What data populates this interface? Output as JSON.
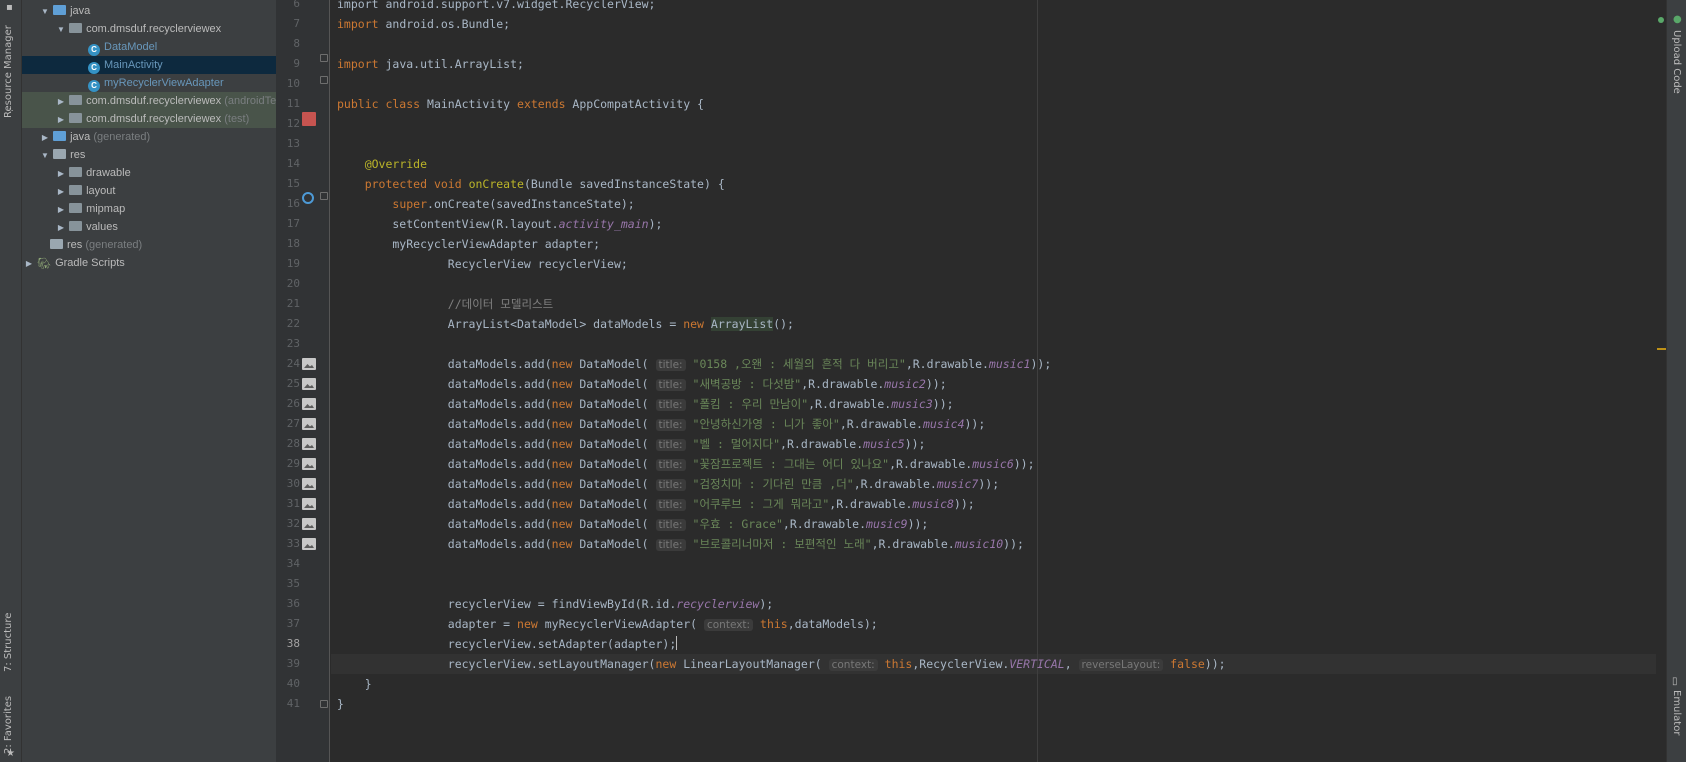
{
  "left_strip": {
    "tabs": [
      {
        "label": "Resource Manager"
      },
      {
        "label": "7: Structure"
      },
      {
        "label": "2: Favorites"
      }
    ]
  },
  "project_tree": {
    "rows": [
      {
        "text": "java",
        "suffix": ""
      },
      {
        "text": "com.dmsduf.recyclerviewex",
        "suffix": ""
      },
      {
        "text": "DataModel",
        "suffix": ""
      },
      {
        "text": "MainActivity",
        "suffix": ""
      },
      {
        "text": "myRecyclerViewAdapter",
        "suffix": ""
      },
      {
        "text": "com.dmsduf.recyclerviewex",
        "suffix": "(androidTes"
      },
      {
        "text": "com.dmsduf.recyclerviewex",
        "suffix": "(test)"
      },
      {
        "text": "java",
        "suffix": "(generated)"
      },
      {
        "text": "res",
        "suffix": ""
      },
      {
        "text": "drawable",
        "suffix": ""
      },
      {
        "text": "layout",
        "suffix": ""
      },
      {
        "text": "mipmap",
        "suffix": ""
      },
      {
        "text": "values",
        "suffix": ""
      },
      {
        "text": "res",
        "suffix": "(generated)"
      },
      {
        "text": "Gradle Scripts",
        "suffix": ""
      }
    ]
  },
  "gutter": {
    "line_numbers": [
      "6",
      "7",
      "8",
      "9",
      "10",
      "11",
      "12",
      "13",
      "14",
      "15",
      "16",
      "17",
      "18",
      "19",
      "20",
      "21",
      "22",
      "23",
      "24",
      "25",
      "26",
      "27",
      "28",
      "29",
      "30",
      "31",
      "32",
      "33",
      "34",
      "35",
      "36",
      "37",
      "38",
      "39",
      "40",
      "41"
    ]
  },
  "code": {
    "lines": [
      [
        {
          "t": "plain",
          "v": "import android.support.v7.widget.RecyclerView;"
        }
      ],
      [
        {
          "t": "kw",
          "v": "import "
        },
        {
          "t": "plain",
          "v": "android.os.Bundle;"
        }
      ],
      [],
      [
        {
          "t": "kw",
          "v": "import "
        },
        {
          "t": "plain",
          "v": "java.util.ArrayList;"
        }
      ],
      [],
      [
        {
          "t": "kw",
          "v": "public class "
        },
        {
          "t": "plain",
          "v": "MainActivity "
        },
        {
          "t": "kw",
          "v": "extends "
        },
        {
          "t": "plain",
          "v": "AppCompatActivity {"
        }
      ],
      [],
      [],
      [
        {
          "t": "plain",
          "v": "    "
        },
        {
          "t": "ann",
          "v": "@Override"
        }
      ],
      [
        {
          "t": "plain",
          "v": "    "
        },
        {
          "t": "kw",
          "v": "protected void "
        },
        {
          "t": "ann",
          "v": "onCreate"
        },
        {
          "t": "plain",
          "v": "(Bundle savedInstanceState) {"
        }
      ],
      [
        {
          "t": "plain",
          "v": "        "
        },
        {
          "t": "kw",
          "v": "super"
        },
        {
          "t": "plain",
          "v": ".onCreate(savedInstanceState);"
        }
      ],
      [
        {
          "t": "plain",
          "v": "        setContentView(R.layout."
        },
        {
          "t": "italic",
          "v": "activity_main"
        },
        {
          "t": "plain",
          "v": ");"
        }
      ],
      [
        {
          "t": "plain",
          "v": "        myRecyclerViewAdapter adapter;"
        }
      ],
      [
        {
          "t": "plain",
          "v": "                RecyclerView recyclerView;"
        }
      ],
      [],
      [
        {
          "t": "plain",
          "v": "                "
        },
        {
          "t": "com",
          "v": "//데이터 모델리스트"
        }
      ],
      [
        {
          "t": "plain",
          "v": "                ArrayList<DataModel> dataModels = "
        },
        {
          "t": "kw",
          "v": "new "
        },
        {
          "t": "hl",
          "v": "ArrayList"
        },
        {
          "t": "plain",
          "v": "();"
        }
      ],
      [],
      [
        {
          "t": "plain",
          "v": "                dataModels.add("
        },
        {
          "t": "kw",
          "v": "new "
        },
        {
          "t": "plain",
          "v": "DataModel( "
        },
        {
          "t": "hint",
          "v": "title:"
        },
        {
          "t": "str",
          "v": " \"0158 ,오왠 : 세월의 흔적 다 버리고\""
        },
        {
          "t": "plain",
          "v": ",R.drawable."
        },
        {
          "t": "italic",
          "v": "music1"
        },
        {
          "t": "plain",
          "v": "));"
        }
      ],
      [
        {
          "t": "plain",
          "v": "                dataModels.add("
        },
        {
          "t": "kw",
          "v": "new "
        },
        {
          "t": "plain",
          "v": "DataModel( "
        },
        {
          "t": "hint",
          "v": "title:"
        },
        {
          "t": "str",
          "v": " \"새벽공방 : 다섯밤\""
        },
        {
          "t": "plain",
          "v": ",R.drawable."
        },
        {
          "t": "italic",
          "v": "music2"
        },
        {
          "t": "plain",
          "v": "));"
        }
      ],
      [
        {
          "t": "plain",
          "v": "                dataModels.add("
        },
        {
          "t": "kw",
          "v": "new "
        },
        {
          "t": "plain",
          "v": "DataModel( "
        },
        {
          "t": "hint",
          "v": "title:"
        },
        {
          "t": "str",
          "v": " \"폴킴 : 우리 만남이\""
        },
        {
          "t": "plain",
          "v": ",R.drawable."
        },
        {
          "t": "italic",
          "v": "music3"
        },
        {
          "t": "plain",
          "v": "));"
        }
      ],
      [
        {
          "t": "plain",
          "v": "                dataModels.add("
        },
        {
          "t": "kw",
          "v": "new "
        },
        {
          "t": "plain",
          "v": "DataModel( "
        },
        {
          "t": "hint",
          "v": "title:"
        },
        {
          "t": "str",
          "v": " \"안녕하신가영 : 니가 좋아\""
        },
        {
          "t": "plain",
          "v": ",R.drawable."
        },
        {
          "t": "italic",
          "v": "music4"
        },
        {
          "t": "plain",
          "v": "));"
        }
      ],
      [
        {
          "t": "plain",
          "v": "                dataModels.add("
        },
        {
          "t": "kw",
          "v": "new "
        },
        {
          "t": "plain",
          "v": "DataModel( "
        },
        {
          "t": "hint",
          "v": "title:"
        },
        {
          "t": "str",
          "v": " \"벨 : 멀어지다\""
        },
        {
          "t": "plain",
          "v": ",R.drawable."
        },
        {
          "t": "italic",
          "v": "music5"
        },
        {
          "t": "plain",
          "v": "));"
        }
      ],
      [
        {
          "t": "plain",
          "v": "                dataModels.add("
        },
        {
          "t": "kw",
          "v": "new "
        },
        {
          "t": "plain",
          "v": "DataModel( "
        },
        {
          "t": "hint",
          "v": "title:"
        },
        {
          "t": "str",
          "v": " \"꽃잠프로젝트 : 그대는 어디 있나요\""
        },
        {
          "t": "plain",
          "v": ",R.drawable."
        },
        {
          "t": "italic",
          "v": "music6"
        },
        {
          "t": "plain",
          "v": "));"
        }
      ],
      [
        {
          "t": "plain",
          "v": "                dataModels.add("
        },
        {
          "t": "kw",
          "v": "new "
        },
        {
          "t": "plain",
          "v": "DataModel( "
        },
        {
          "t": "hint",
          "v": "title:"
        },
        {
          "t": "str",
          "v": " \"검정치마 : 기다린 만큼 ,더\""
        },
        {
          "t": "plain",
          "v": ",R.drawable."
        },
        {
          "t": "italic",
          "v": "music7"
        },
        {
          "t": "plain",
          "v": "));"
        }
      ],
      [
        {
          "t": "plain",
          "v": "                dataModels.add("
        },
        {
          "t": "kw",
          "v": "new "
        },
        {
          "t": "plain",
          "v": "DataModel( "
        },
        {
          "t": "hint",
          "v": "title:"
        },
        {
          "t": "str",
          "v": " \"어쿠루브 : 그게 뭐라고\""
        },
        {
          "t": "plain",
          "v": ",R.drawable."
        },
        {
          "t": "italic",
          "v": "music8"
        },
        {
          "t": "plain",
          "v": "));"
        }
      ],
      [
        {
          "t": "plain",
          "v": "                dataModels.add("
        },
        {
          "t": "kw",
          "v": "new "
        },
        {
          "t": "plain",
          "v": "DataModel( "
        },
        {
          "t": "hint",
          "v": "title:"
        },
        {
          "t": "str",
          "v": " \"우효 : Grace\""
        },
        {
          "t": "plain",
          "v": ",R.drawable."
        },
        {
          "t": "italic",
          "v": "music9"
        },
        {
          "t": "plain",
          "v": "));"
        }
      ],
      [
        {
          "t": "plain",
          "v": "                dataModels.add("
        },
        {
          "t": "kw",
          "v": "new "
        },
        {
          "t": "plain",
          "v": "DataModel( "
        },
        {
          "t": "hint",
          "v": "title:"
        },
        {
          "t": "str",
          "v": " \"브로콜리너마저 : 보편적인 노래\""
        },
        {
          "t": "plain",
          "v": ",R.drawable."
        },
        {
          "t": "italic",
          "v": "music10"
        },
        {
          "t": "plain",
          "v": "));"
        }
      ],
      [],
      [],
      [
        {
          "t": "plain",
          "v": "                recyclerView = findViewById(R.id."
        },
        {
          "t": "italic",
          "v": "recyclerview"
        },
        {
          "t": "plain",
          "v": ");"
        }
      ],
      [
        {
          "t": "plain",
          "v": "                adapter = "
        },
        {
          "t": "kw",
          "v": "new "
        },
        {
          "t": "plain",
          "v": "myRecyclerViewAdapter( "
        },
        {
          "t": "hint",
          "v": "context:"
        },
        {
          "t": "kw",
          "v": " this"
        },
        {
          "t": "plain",
          "v": ",dataModels);"
        }
      ],
      [
        {
          "t": "plain",
          "v": "                recyclerView.setAdapter(adapter);"
        },
        {
          "t": "caret",
          "v": ""
        }
      ],
      [
        {
          "t": "plain",
          "v": "                recyclerView.setLayoutManager("
        },
        {
          "t": "kw",
          "v": "new "
        },
        {
          "t": "plain",
          "v": "LinearLayoutManager( "
        },
        {
          "t": "hint",
          "v": "context:"
        },
        {
          "t": "kw",
          "v": " this"
        },
        {
          "t": "plain",
          "v": ",RecyclerView."
        },
        {
          "t": "italic",
          "v": "VERTICAL"
        },
        {
          "t": "plain",
          "v": ", "
        },
        {
          "t": "hint",
          "v": "reverseLayout:"
        },
        {
          "t": "kw",
          "v": " false"
        },
        {
          "t": "plain",
          "v": "));"
        }
      ],
      [
        {
          "t": "plain",
          "v": "    }"
        }
      ],
      [
        {
          "t": "plain",
          "v": "}"
        }
      ]
    ],
    "current_line": "38"
  },
  "right_strip": {
    "tabs": [
      {
        "label": "Upload Code"
      },
      {
        "label": "Emulator"
      }
    ]
  },
  "colors": {
    "keyword": "#cc7832",
    "string": "#6a8759",
    "annotation": "#bbb529",
    "comment": "#808080",
    "field": "#9876aa",
    "text": "#a9b7c6",
    "selection": "#0d293e"
  }
}
